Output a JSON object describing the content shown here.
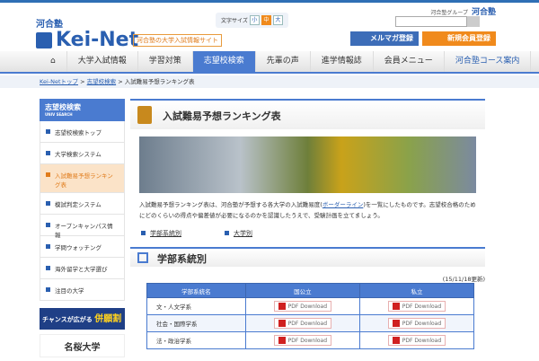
{
  "header": {
    "group": "河合塾グループ",
    "group_logo": "河合塾",
    "logo_top": "河合塾",
    "logo": "Kei-Net",
    "tagline": "河合塾の大学入試情報サイト",
    "font_size_label": "文字サイズ",
    "font_sizes": [
      "小",
      "中",
      "大"
    ],
    "mailmag": "メルマガ登録",
    "register": "新規会員登録"
  },
  "nav": [
    "大学入試情報",
    "学習対策",
    "志望校検索",
    "先輩の声",
    "進学情報誌",
    "会員メニュー",
    "河合塾コース案内"
  ],
  "breadcrumb": {
    "items": [
      "Kei-Netトップ",
      "志望校検索"
    ],
    "current": "入試難易予想ランキング表",
    "sep": ">"
  },
  "sidebar": {
    "title": "志望校検索",
    "subtitle": "UNIV SEARCH",
    "items": [
      "志望校検索トップ",
      "大学検索システム",
      "入試難易予想ランキング表",
      "模試判定システム",
      "オープンキャンパス情報",
      "学問ウォッチング",
      "海外留学と大学選び",
      "注目の大学"
    ],
    "banner1": "チャンスが広がる",
    "banner1_b": "併願割",
    "banner2": "名桜大学"
  },
  "main": {
    "title": "入試難易予想ランキング表",
    "desc1": "入試難易予想ランキング表は、河合塾が予想する各大学の入試難易度(",
    "desc_link": "ボーダーライン",
    "desc2": ")を一覧にしたものです。志望校合格のためにどのくらいの得点や偏差値が必要になるのかを認識したうえで、受験計画を立てましょう。",
    "links": [
      "学部系統別",
      "大学別"
    ],
    "section": "学部系統別",
    "updated": "(15/11/18更新)",
    "table": {
      "headers": [
        "学部系統名",
        "国公立",
        "私立"
      ],
      "rows": [
        "文・人文学系",
        "社会・国際学系",
        "法・政治学系"
      ],
      "pdf": "PDF Download"
    }
  }
}
